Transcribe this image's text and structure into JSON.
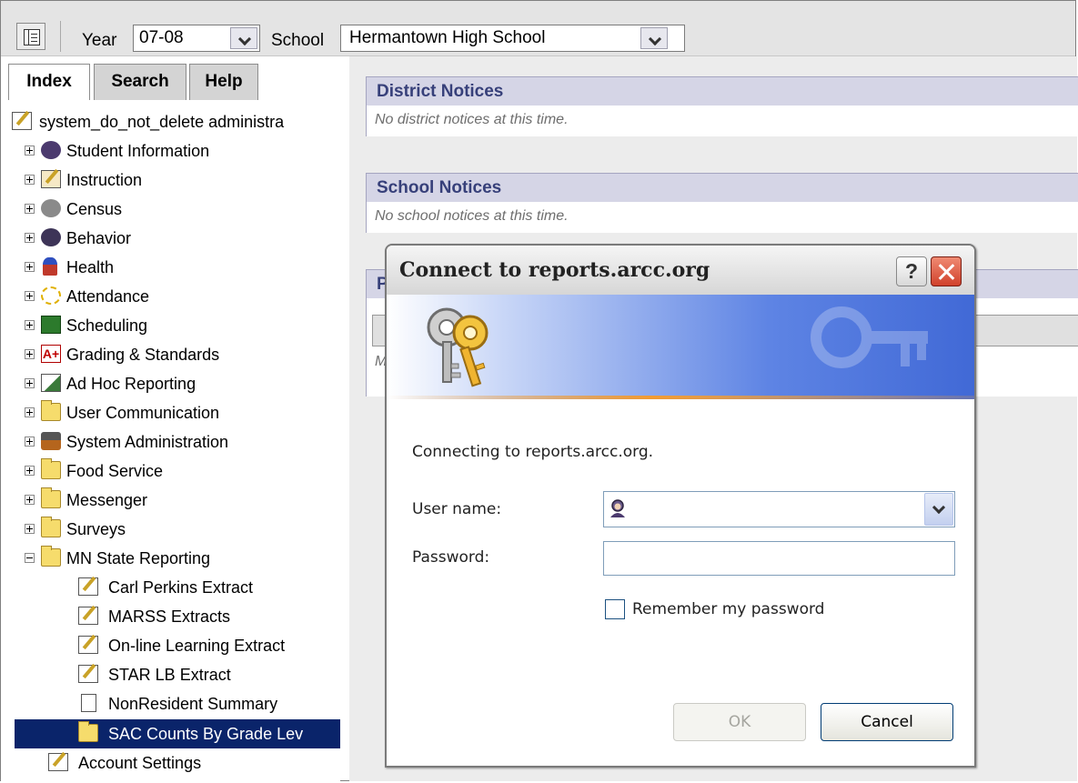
{
  "topbar": {
    "year_label": "Year",
    "year_value": "07-08",
    "school_label": "School",
    "school_value": "Hermantown High School"
  },
  "tabs": [
    "Index",
    "Search",
    "Help"
  ],
  "tree": {
    "root": "system_do_not_delete administra",
    "items": [
      "Student Information",
      "Instruction",
      "Census",
      "Behavior",
      "Health",
      "Attendance",
      "Scheduling",
      "Grading & Standards",
      "Ad Hoc Reporting",
      "User Communication",
      "System Administration",
      "Food Service",
      "Messenger",
      "Surveys",
      "MN State Reporting"
    ],
    "children": [
      "Carl Perkins Extract",
      "MARSS Extracts",
      "On-line Learning Extract",
      "STAR LB Extract",
      "NonResident Summary",
      "SAC Counts By Grade Lev"
    ],
    "account_settings": "Account Settings"
  },
  "notices": {
    "district_title": "District Notices",
    "district_body": "No district notices at this time.",
    "school_title": "School Notices",
    "school_body": "No school notices at this time.",
    "partial_title": "P",
    "partial_row": "M"
  },
  "dialog": {
    "title": "Connect to reports.arcc.org",
    "help": "?",
    "message": "Connecting to reports.arcc.org.",
    "username_label": "User name:",
    "password_label": "Password:",
    "remember_label": "Remember my password",
    "ok": "OK",
    "cancel": "Cancel"
  },
  "colors": {
    "selection": "#0a246a",
    "notice_header_bg": "#d5d5e6",
    "notice_header_text": "#37407a",
    "dialog_close": "#d1412b"
  }
}
